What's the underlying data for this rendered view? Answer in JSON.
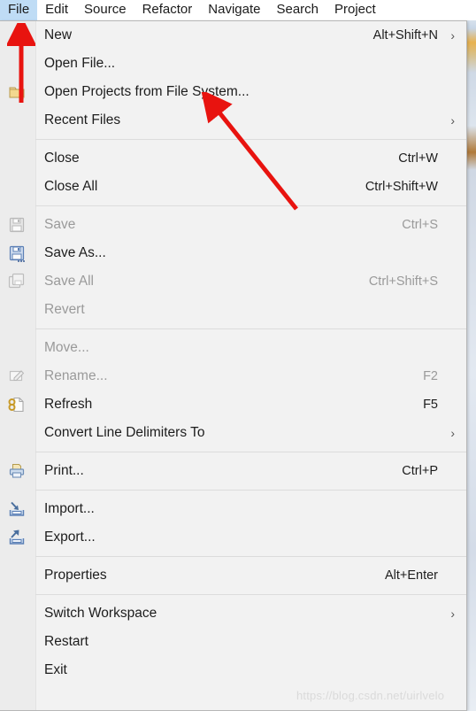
{
  "menubar": {
    "items": [
      {
        "label": "File",
        "active": true
      },
      {
        "label": "Edit",
        "active": false
      },
      {
        "label": "Source",
        "active": false
      },
      {
        "label": "Refactor",
        "active": false
      },
      {
        "label": "Navigate",
        "active": false
      },
      {
        "label": "Search",
        "active": false
      },
      {
        "label": "Project",
        "active": false
      }
    ]
  },
  "file_menu": {
    "items": [
      {
        "label": "New",
        "accel": "Alt+Shift+N",
        "submenu": "›",
        "icon": "",
        "disabled": false
      },
      {
        "label": "Open File...",
        "accel": "",
        "submenu": "",
        "icon": "",
        "disabled": false
      },
      {
        "label": "Open Projects from File System...",
        "accel": "",
        "submenu": "",
        "icon": "folder-open-icon",
        "disabled": false
      },
      {
        "label": "Recent Files",
        "accel": "",
        "submenu": "›",
        "icon": "",
        "disabled": false
      },
      {
        "separator": true
      },
      {
        "label": "Close",
        "accel": "Ctrl+W",
        "submenu": "",
        "icon": "",
        "disabled": false
      },
      {
        "label": "Close All",
        "accel": "Ctrl+Shift+W",
        "submenu": "",
        "icon": "",
        "disabled": false
      },
      {
        "separator": true
      },
      {
        "label": "Save",
        "accel": "Ctrl+S",
        "submenu": "",
        "icon": "save-icon",
        "disabled": true
      },
      {
        "label": "Save As...",
        "accel": "",
        "submenu": "",
        "icon": "save-as-icon",
        "disabled": false
      },
      {
        "label": "Save All",
        "accel": "Ctrl+Shift+S",
        "submenu": "",
        "icon": "save-all-icon",
        "disabled": true
      },
      {
        "label": "Revert",
        "accel": "",
        "submenu": "",
        "icon": "",
        "disabled": true
      },
      {
        "separator": true
      },
      {
        "label": "Move...",
        "accel": "",
        "submenu": "",
        "icon": "",
        "disabled": true
      },
      {
        "label": "Rename...",
        "accel": "F2",
        "submenu": "",
        "icon": "rename-icon",
        "disabled": true
      },
      {
        "label": "Refresh",
        "accel": "F5",
        "submenu": "",
        "icon": "refresh-icon",
        "disabled": false
      },
      {
        "label": "Convert Line Delimiters To",
        "accel": "",
        "submenu": "›",
        "icon": "",
        "disabled": false
      },
      {
        "separator": true
      },
      {
        "label": "Print...",
        "accel": "Ctrl+P",
        "submenu": "",
        "icon": "print-icon",
        "disabled": false
      },
      {
        "separator": true
      },
      {
        "label": "Import...",
        "accel": "",
        "submenu": "",
        "icon": "import-icon",
        "disabled": false
      },
      {
        "label": "Export...",
        "accel": "",
        "submenu": "",
        "icon": "export-icon",
        "disabled": false
      },
      {
        "separator": true
      },
      {
        "label": "Properties",
        "accel": "Alt+Enter",
        "submenu": "",
        "icon": "",
        "disabled": false
      },
      {
        "separator": true
      },
      {
        "label": "Switch Workspace",
        "accel": "",
        "submenu": "›",
        "icon": "",
        "disabled": false
      },
      {
        "label": "Restart",
        "accel": "",
        "submenu": "",
        "icon": "",
        "disabled": false
      },
      {
        "label": "Exit",
        "accel": "",
        "submenu": "",
        "icon": "",
        "disabled": false
      }
    ]
  },
  "annotations": {
    "arrow_color": "#e8130f",
    "arrow_file_target": "File",
    "arrow_open_target": "Open Projects from File System..."
  },
  "watermark": {
    "text": "https://blog.csdn.net/uirlvelo"
  },
  "colors": {
    "menu_background": "#f2f2f2",
    "menubar_highlight": "#bfdcf5",
    "text": "#1d1d1d",
    "disabled_text": "#9a9a9a",
    "separator": "#dcdcdc"
  }
}
